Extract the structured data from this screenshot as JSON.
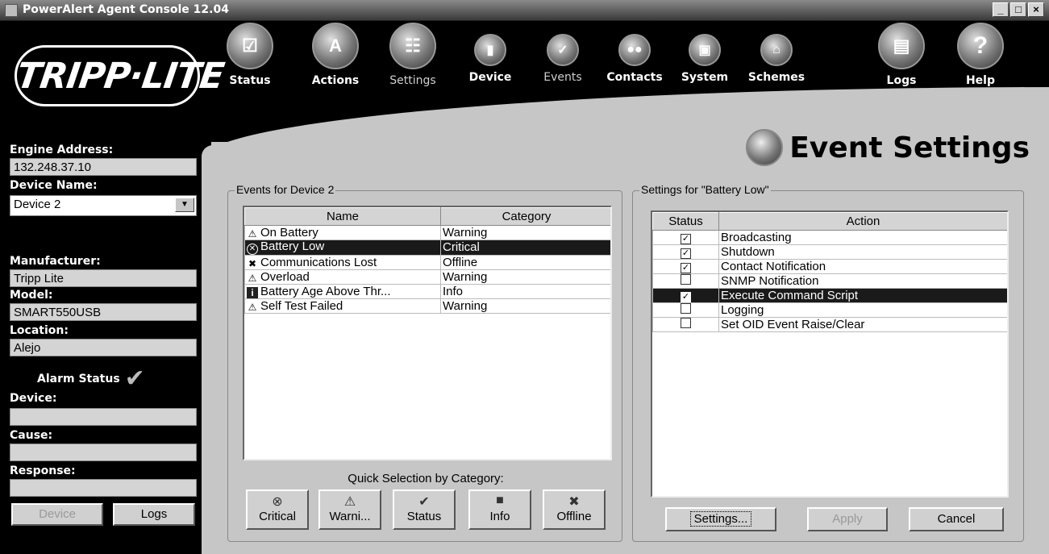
{
  "window": {
    "title": "PowerAlert Agent Console 12.04",
    "controls": [
      "_",
      "□",
      "×"
    ]
  },
  "brand": {
    "logo_text": "TRIPP·LITE"
  },
  "nav": {
    "status": "Status",
    "actions": "Actions",
    "settings": "Settings",
    "device": "Device",
    "events": "Events",
    "contacts": "Contacts",
    "system": "System",
    "schemes": "Schemes",
    "logs": "Logs",
    "help": "Help"
  },
  "page_title": "Event Settings",
  "sidebar": {
    "engine_address_label": "Engine Address:",
    "engine_address": "132.248.37.10",
    "device_name_label": "Device Name:",
    "device_name": "Device 2",
    "manufacturer_label": "Manufacturer:",
    "manufacturer": "Tripp Lite",
    "model_label": "Model:",
    "model": "SMART550USB",
    "location_label": "Location:",
    "location": "Alejo",
    "alarm_status_label": "Alarm Status",
    "device_label": "Device:",
    "device_value": "",
    "cause_label": "Cause:",
    "cause_value": "",
    "response_label": "Response:",
    "response_value": "",
    "device_button": "Device",
    "logs_button": "Logs"
  },
  "events_panel": {
    "title": "Events for Device 2",
    "columns": [
      "Name",
      "Category"
    ],
    "rows": [
      {
        "icon": "warning-icon",
        "name": "On Battery",
        "category": "Warning"
      },
      {
        "icon": "critical-icon",
        "name": "Battery Low",
        "category": "Critical",
        "selected": true
      },
      {
        "icon": "offline-icon",
        "name": "Communications Lost",
        "category": "Offline"
      },
      {
        "icon": "warning-icon",
        "name": "Overload",
        "category": "Warning"
      },
      {
        "icon": "info-icon",
        "name": "Battery Age Above Thr...",
        "category": "Info"
      },
      {
        "icon": "warning-icon",
        "name": "Self Test Failed",
        "category": "Warning"
      }
    ],
    "quick_label": "Quick Selection by Category:",
    "quick_buttons": [
      "Critical",
      "Warni...",
      "Status",
      "Info",
      "Offline"
    ]
  },
  "settings_panel": {
    "title": "Settings for \"Battery Low\"",
    "columns": [
      "Status",
      "Action"
    ],
    "rows": [
      {
        "checked": true,
        "action": "Broadcasting"
      },
      {
        "checked": true,
        "action": "Shutdown"
      },
      {
        "checked": true,
        "action": "Contact Notification"
      },
      {
        "checked": false,
        "action": "SNMP Notification"
      },
      {
        "checked": true,
        "action": "Execute Command Script",
        "selected": true
      },
      {
        "checked": false,
        "action": "Logging"
      },
      {
        "checked": false,
        "action": "Set OID Event Raise/Clear"
      }
    ],
    "settings_button": "Settings...",
    "apply_button": "Apply",
    "cancel_button": "Cancel"
  }
}
